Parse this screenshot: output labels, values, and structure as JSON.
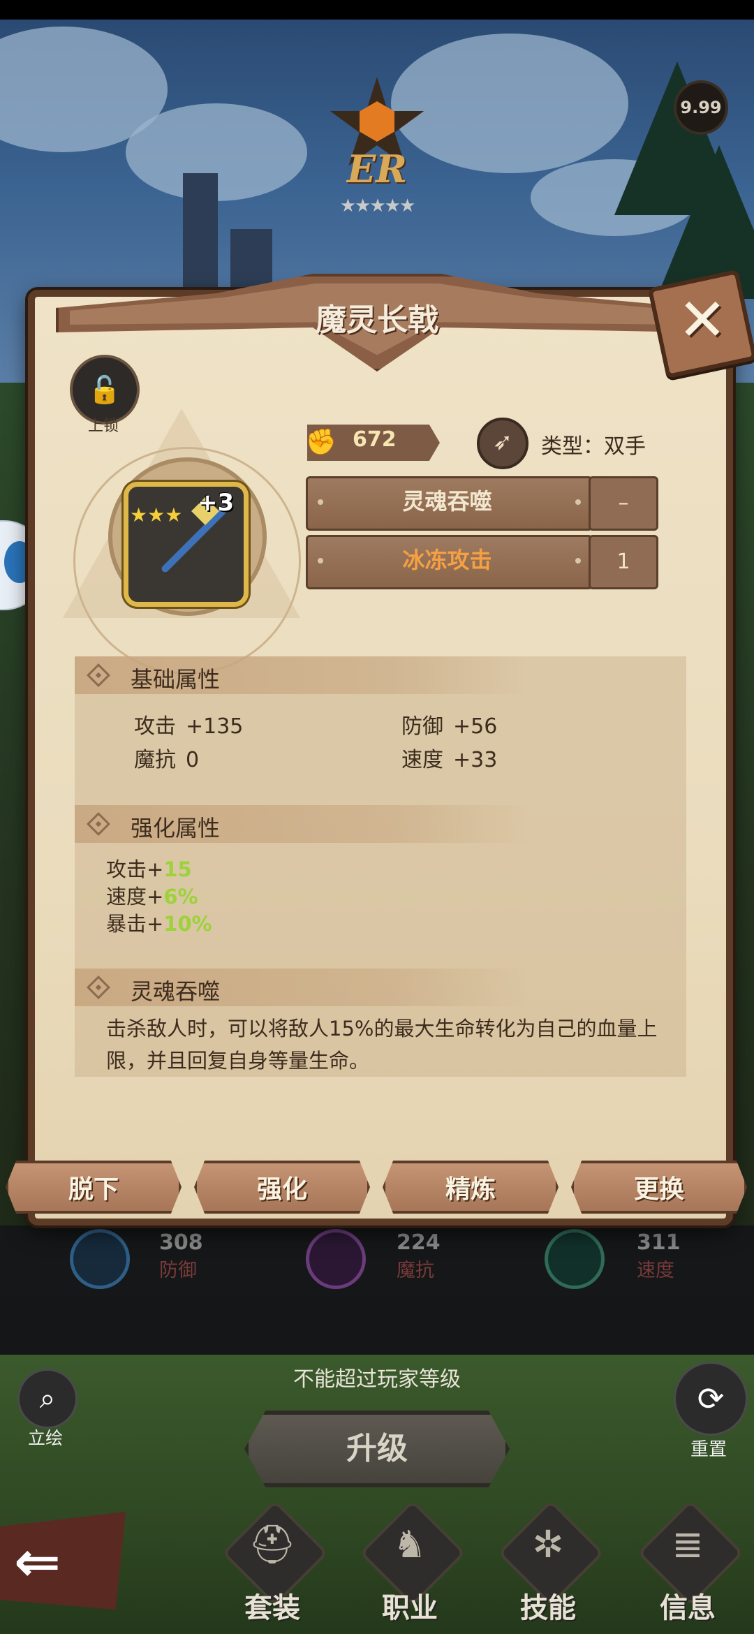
{
  "header": {
    "power_badge": "9.99"
  },
  "rank": {
    "label": "ER",
    "stars": "★★★★★"
  },
  "panel": {
    "title": "魔灵长戟",
    "close_glyph": "✕",
    "lock_label": "上锁",
    "item": {
      "plus_level": "+3",
      "star_glyphs": "★★★"
    },
    "power_value": "672",
    "type_label": "类型：双手",
    "skills": [
      {
        "name": "灵魂吞噬",
        "level": "–",
        "color": "#f2e7cf"
      },
      {
        "name": "冰冻攻击",
        "level": "1",
        "color": "#f5a043"
      }
    ],
    "base_section": {
      "title": "基础属性",
      "stats": [
        {
          "label": "攻击",
          "value": "+135"
        },
        {
          "label": "防御",
          "value": "+56"
        },
        {
          "label": "魔抗",
          "value": "0"
        },
        {
          "label": "速度",
          "value": "+33"
        }
      ]
    },
    "enhance_section": {
      "title": "强化属性",
      "lines": [
        {
          "label": "攻击+",
          "value": "15"
        },
        {
          "label": "速度+",
          "value": "6%"
        },
        {
          "label": "暴击+",
          "value": "10%"
        }
      ]
    },
    "skill_section": {
      "title": "灵魂吞噬",
      "description": "击杀敌人时，可以将敌人15%的最大生命转化为自己的血量上限，并且回复自身等量生命。"
    },
    "buttons": {
      "unequip": "脱下",
      "enhance": "强化",
      "refine": "精炼",
      "replace": "更换"
    }
  },
  "hero_stats": [
    {
      "value": "308",
      "label": "防御",
      "color": "#2f5f86"
    },
    {
      "value": "224",
      "label": "魔抗",
      "color": "#6a3c7c"
    },
    {
      "value": "311",
      "label": "速度",
      "color": "#2f6b57"
    }
  ],
  "bottom": {
    "level_note": "不能超过玩家等级",
    "portrait_label": "立绘",
    "reset_label": "重置",
    "upgrade_label": "升级",
    "tabs": [
      {
        "label": "套装",
        "icon": "helmet-icon",
        "glyph": "⛑"
      },
      {
        "label": "职业",
        "icon": "chess-knight-icon",
        "glyph": "♞"
      },
      {
        "label": "技能",
        "icon": "skill-icon",
        "glyph": "✲"
      },
      {
        "label": "信息",
        "icon": "document-icon",
        "glyph": "≣"
      }
    ]
  }
}
